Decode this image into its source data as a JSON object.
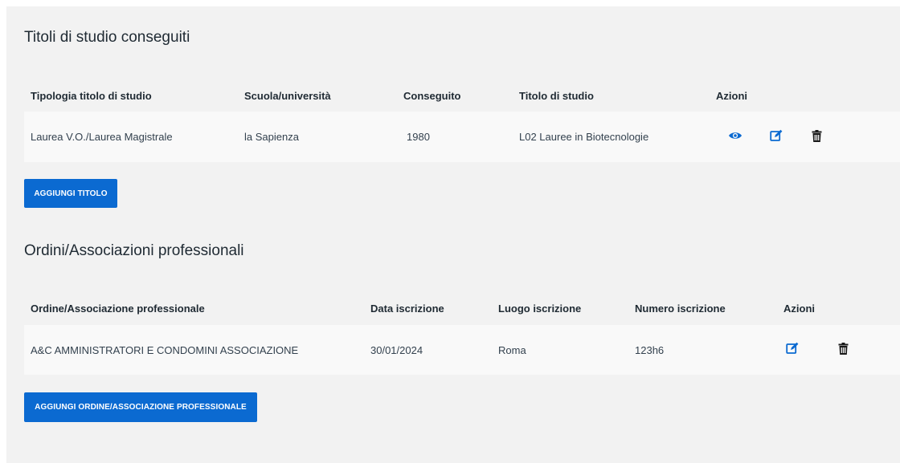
{
  "titoli": {
    "title": "Titoli di studio conseguiti",
    "columns": [
      "Tipologia titolo di studio",
      "Scuola/università",
      "Conseguito",
      "Titolo di studio",
      "Azioni"
    ],
    "rows": [
      {
        "tipologia": "Laurea V.O./Laurea Magistrale",
        "scuola": "la Sapienza",
        "conseguito": "1980",
        "titolo": "L02 Lauree in Biotecnologie"
      }
    ],
    "add_button": "AGGIUNGI TITOLO"
  },
  "ordini": {
    "title": "Ordini/Associazioni professionali",
    "columns": [
      "Ordine/Associazione professionale",
      "Data iscrizione",
      "Luogo iscrizione",
      "Numero iscrizione",
      "Azioni"
    ],
    "rows": [
      {
        "ordine": "A&C AMMINISTRATORI E CONDOMINI ASSOCIAZIONE",
        "data": "30/01/2024",
        "luogo": "Roma",
        "numero": "123h6"
      }
    ],
    "add_button": "AGGIUNGI ORDINE/ASSOCIAZIONE PROFESSIONALE"
  },
  "icons": {
    "view": "eye-icon",
    "edit": "edit-icon",
    "delete": "trash-icon"
  },
  "colors": {
    "primary": "#0b6ad1",
    "panel_bg": "#f2f2f2",
    "row_bg": "#f9f9f9",
    "trash": "#1a1a1a"
  }
}
